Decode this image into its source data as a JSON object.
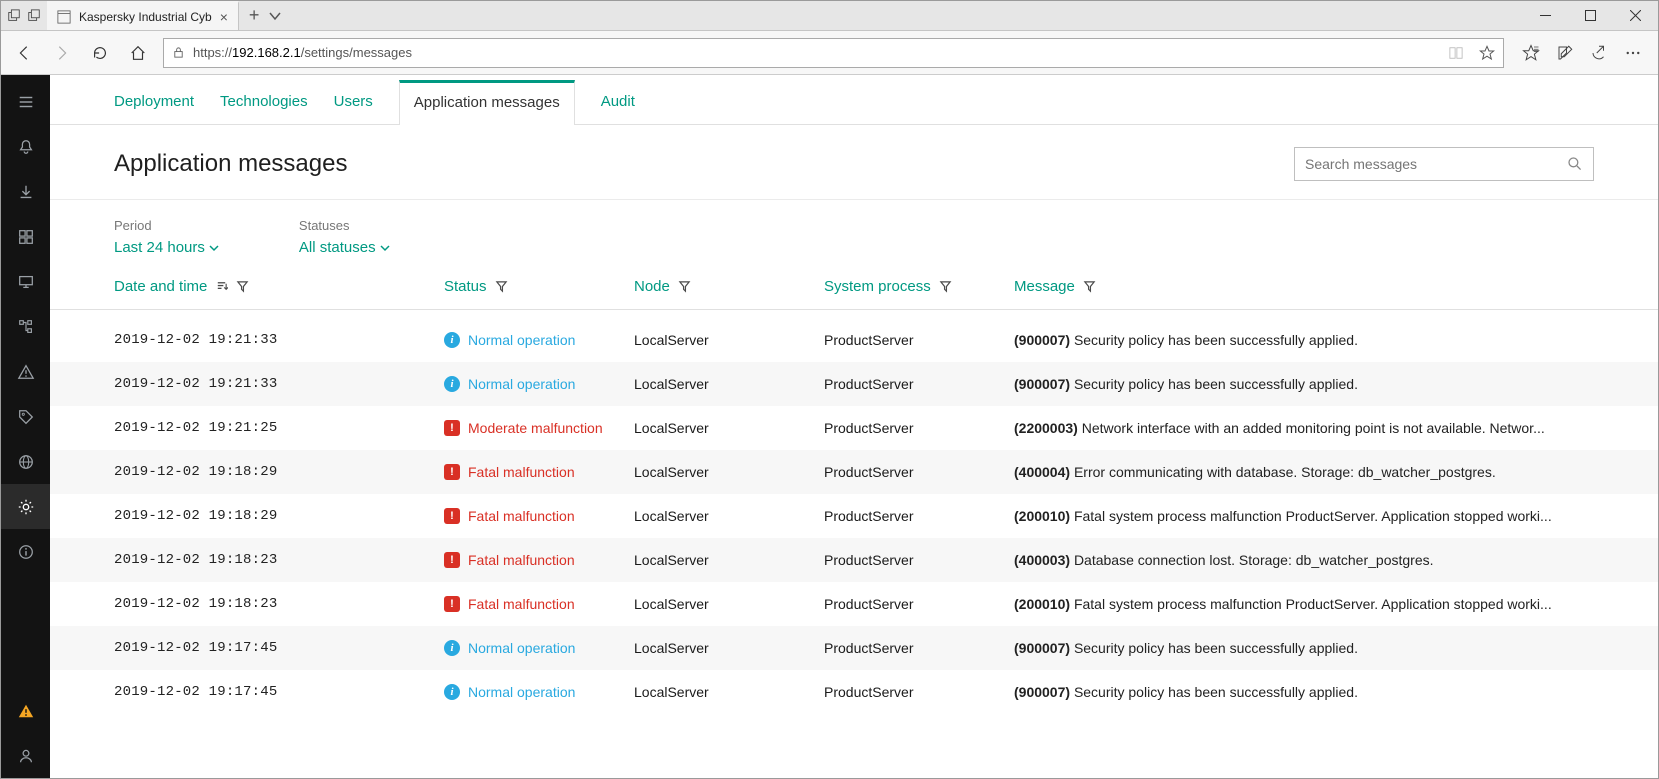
{
  "browser": {
    "tab_title": "Kaspersky Industrial Cyb",
    "url_prefix": "https://",
    "url_host": "192.168.2.1",
    "url_path": "/settings/messages"
  },
  "tabs": {
    "items": [
      {
        "label": "Deployment"
      },
      {
        "label": "Technologies"
      },
      {
        "label": "Users"
      },
      {
        "label": "Application messages"
      },
      {
        "label": "Audit"
      }
    ],
    "active_index": 3
  },
  "page": {
    "title": "Application messages",
    "search_placeholder": "Search messages"
  },
  "filters": {
    "period_label": "Period",
    "period_value": "Last 24 hours",
    "statuses_label": "Statuses",
    "statuses_value": "All statuses"
  },
  "columns": {
    "date": "Date and time",
    "status": "Status",
    "node": "Node",
    "process": "System process",
    "message": "Message"
  },
  "status_labels": {
    "normal": "Normal operation",
    "moderate": "Moderate malfunction",
    "fatal": "Fatal malfunction"
  },
  "rows": [
    {
      "date": "2019-12-02 19:21:33",
      "status": "normal",
      "node": "LocalServer",
      "process": "ProductServer",
      "code": "(900007)",
      "msg": "Security policy has been successfully applied."
    },
    {
      "date": "2019-12-02 19:21:33",
      "status": "normal",
      "node": "LocalServer",
      "process": "ProductServer",
      "code": "(900007)",
      "msg": "Security policy has been successfully applied."
    },
    {
      "date": "2019-12-02 19:21:25",
      "status": "moderate",
      "node": "LocalServer",
      "process": "ProductServer",
      "code": "(2200003)",
      "msg": "Network interface with an added monitoring point is not available. Networ..."
    },
    {
      "date": "2019-12-02 19:18:29",
      "status": "fatal",
      "node": "LocalServer",
      "process": "ProductServer",
      "code": "(400004)",
      "msg": "Error communicating with database. Storage: db_watcher_postgres."
    },
    {
      "date": "2019-12-02 19:18:29",
      "status": "fatal",
      "node": "LocalServer",
      "process": "ProductServer",
      "code": "(200010)",
      "msg": "Fatal system process malfunction ProductServer. Application stopped worki..."
    },
    {
      "date": "2019-12-02 19:18:23",
      "status": "fatal",
      "node": "LocalServer",
      "process": "ProductServer",
      "code": "(400003)",
      "msg": "Database connection lost. Storage: db_watcher_postgres."
    },
    {
      "date": "2019-12-02 19:18:23",
      "status": "fatal",
      "node": "LocalServer",
      "process": "ProductServer",
      "code": "(200010)",
      "msg": "Fatal system process malfunction ProductServer. Application stopped worki..."
    },
    {
      "date": "2019-12-02 19:17:45",
      "status": "normal",
      "node": "LocalServer",
      "process": "ProductServer",
      "code": "(900007)",
      "msg": "Security policy has been successfully applied."
    },
    {
      "date": "2019-12-02 19:17:45",
      "status": "normal",
      "node": "LocalServer",
      "process": "ProductServer",
      "code": "(900007)",
      "msg": "Security policy has been successfully applied."
    }
  ]
}
